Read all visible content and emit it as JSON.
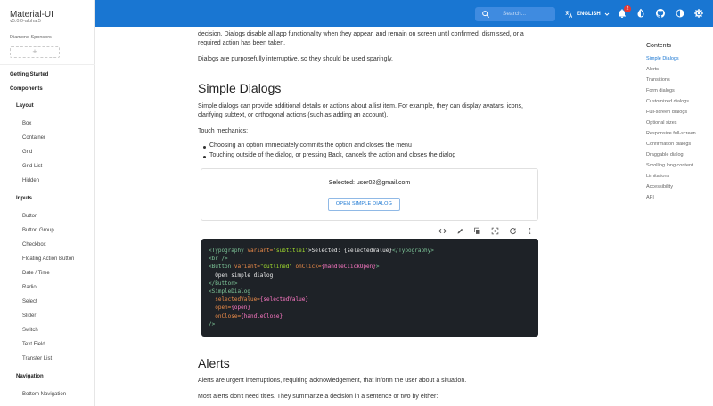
{
  "app": {
    "title": "Material-UI",
    "version": "v5.0.0-alpha.5",
    "sponsors_label": "Diamond Sponsors",
    "sponsor_add": "+"
  },
  "sidebar": {
    "sections": [
      "Getting Started",
      "Components"
    ],
    "layout": {
      "title": "Layout",
      "items": [
        "Box",
        "Container",
        "Grid",
        "Grid List",
        "Hidden"
      ]
    },
    "inputs": {
      "title": "Inputs",
      "items": [
        "Button",
        "Button Group",
        "Checkbox",
        "Floating Action Button",
        "Date / Time",
        "Radio",
        "Select",
        "Slider",
        "Switch",
        "Text Field",
        "Transfer List"
      ]
    },
    "navigation": {
      "title": "Navigation",
      "items": [
        "Bottom Navigation"
      ]
    }
  },
  "topbar": {
    "search_placeholder": "Search...",
    "language": "ENGLISH",
    "notifications_count": "2",
    "brand_color": "#1976d2"
  },
  "content": {
    "intro_p1": "decision. Dialogs disable all app functionality when they appear, and remain on screen until confirmed, dismissed, or a required action has been taken.",
    "intro_p2": "Dialogs are purposefully interruptive, so they should be used sparingly.",
    "simple_heading": "Simple Dialogs",
    "simple_p": "Simple dialogs can provide additional details or actions about a list item. For example, they can display avatars, icons, clarifying subtext, or orthogonal actions (such as adding an account).",
    "touch_label": "Touch mechanics:",
    "bullets": [
      "Choosing an option immediately commits the option and closes the menu",
      "Touching outside of the dialog, or pressing Back, cancels the action and closes the dialog"
    ],
    "demo_selected": "Selected: user02@gmail.com",
    "demo_button": "OPEN SIMPLE DIALOG",
    "alerts_heading": "Alerts",
    "alerts_p1": "Alerts are urgent interruptions, requiring acknowledgement, that inform the user about a situation.",
    "alerts_p2": "Most alerts don't need titles. They summarize a decision in a sentence or two by either:"
  },
  "code": {
    "l1_open": "<Typography",
    "l1_attr": " variant=",
    "l1_str": "\"subtitle1\"",
    "l1_text": ">Selected: {selectedValue}",
    "l1_close": "</Typography>",
    "l2": "<br />",
    "l3_open": "<Button",
    "l3_attr": " variant=",
    "l3_str": "\"outlined\"",
    "l3_attr2": " onClick=",
    "l3_val": "{handleClickOpen}",
    "l3_end": ">",
    "l4": "  Open simple dialog",
    "l5": "</Button>",
    "l6": "<SimpleDialog",
    "l7_attr": "  selectedValue=",
    "l7_val": "{selectedValue}",
    "l8_attr": "  open=",
    "l8_val": "{open}",
    "l9_attr": "  onClose=",
    "l9_val": "{handleClose}",
    "l10": "/>"
  },
  "toc": {
    "title": "Contents",
    "items": [
      "Simple Dialogs",
      "Alerts",
      "Transitions",
      "Form dialogs",
      "Customized dialogs",
      "Full-screen dialogs",
      "Optional sizes",
      "Responsive full-screen",
      "Confirmation dialogs",
      "Draggable dialog",
      "Scrolling long content",
      "Limitations",
      "Accessibility",
      "API"
    ]
  }
}
